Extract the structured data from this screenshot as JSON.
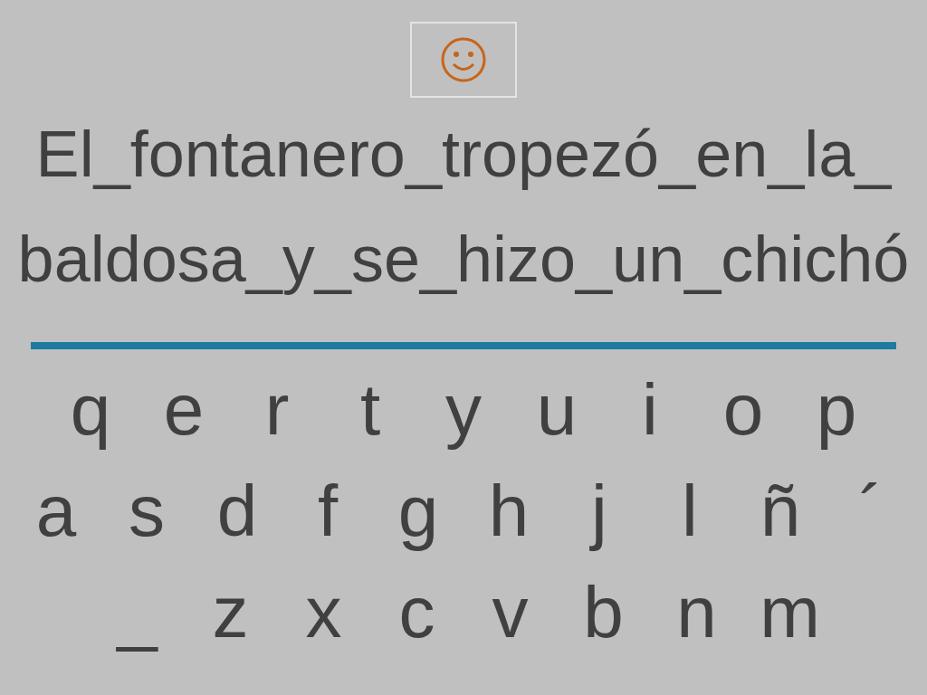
{
  "sentence_lines": [
    "El_fontanero_tropezó_en_la_",
    "baldosa_y_se_hizo_un_chichó"
  ],
  "keyboard_rows": [
    [
      "q",
      "e",
      "r",
      "t",
      "y",
      "u",
      "i",
      "o",
      "p"
    ],
    [
      "a",
      "s",
      "d",
      "f",
      "g",
      "h",
      "j",
      "l",
      "ñ",
      "´"
    ],
    [
      "_",
      "z",
      "x",
      "c",
      "v",
      "b",
      "n",
      "m"
    ]
  ]
}
